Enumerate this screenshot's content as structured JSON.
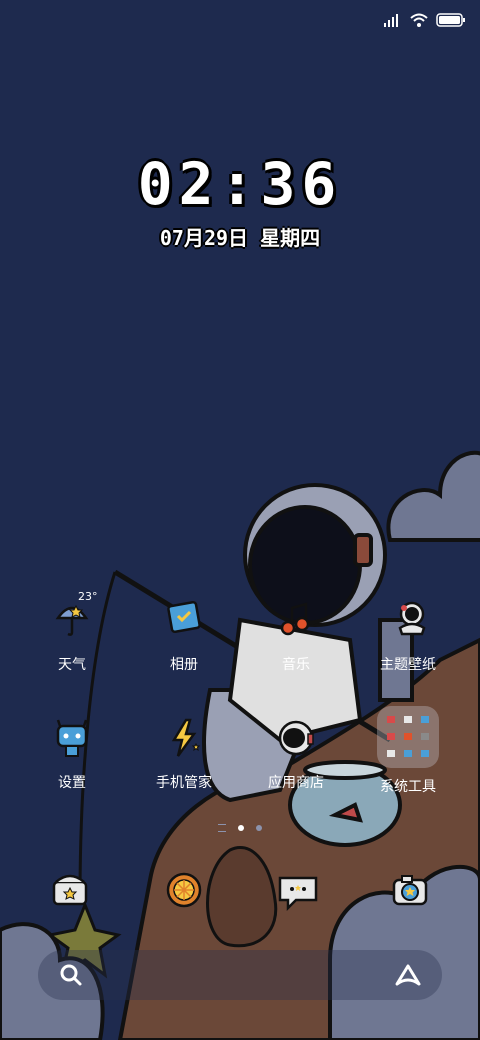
{
  "status_bar": {
    "signal": "signal-icon",
    "wifi": "wifi-icon",
    "battery": "battery-icon"
  },
  "clock": {
    "time": "02:36",
    "date": "07月29日 星期四"
  },
  "weather": {
    "temperature": "23°"
  },
  "apps_row1": [
    {
      "label": "天气",
      "icon": "weather-icon"
    },
    {
      "label": "相册",
      "icon": "gallery-icon"
    },
    {
      "label": "音乐",
      "icon": "music-icon"
    },
    {
      "label": "主题壁纸",
      "icon": "themes-icon"
    }
  ],
  "apps_row2": [
    {
      "label": "设置",
      "icon": "settings-icon"
    },
    {
      "label": "手机管家",
      "icon": "security-icon"
    },
    {
      "label": "应用商店",
      "icon": "app-store-icon"
    },
    {
      "label": "系统工具",
      "icon": "system-tools-folder-icon"
    }
  ],
  "dock": [
    {
      "icon": "phone-icon"
    },
    {
      "icon": "browser-icon"
    },
    {
      "icon": "messages-icon"
    },
    {
      "icon": "camera-icon"
    }
  ],
  "page_indicator": {
    "count": 2,
    "active": 1
  },
  "search": {
    "icon": "search-icon",
    "assistant_icon": "assistant-icon"
  },
  "colors": {
    "background": "#1e2a4e",
    "rock": "#6b4838",
    "cloud": "#6f7792",
    "astronaut": "#9aa0b4"
  }
}
